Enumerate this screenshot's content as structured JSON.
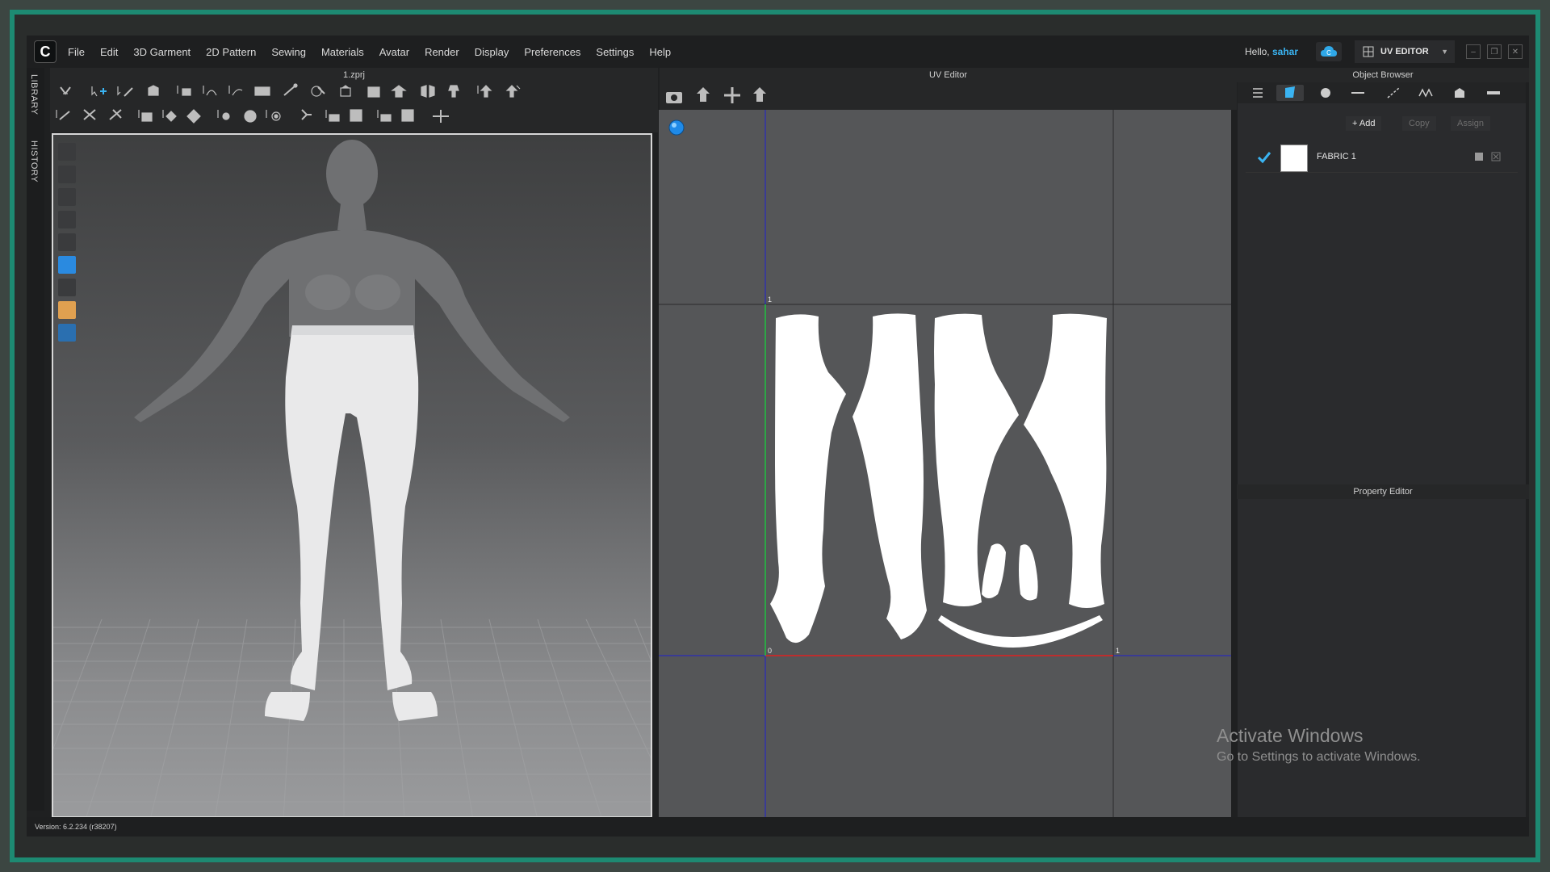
{
  "app": {
    "menu": [
      "File",
      "Edit",
      "3D Garment",
      "2D Pattern",
      "Sewing",
      "Materials",
      "Avatar",
      "Render",
      "Display",
      "Preferences",
      "Settings",
      "Help"
    ],
    "hello_prefix": "Hello,",
    "username": "sahar",
    "mode": "UV EDITOR",
    "window_controls": [
      "–",
      "❐",
      "✕"
    ]
  },
  "side_tabs": [
    "LIBRARY",
    "HISTORY"
  ],
  "viewport3d": {
    "title": "1.zprj"
  },
  "uv_editor": {
    "title": "UV Editor",
    "axis_labels": {
      "top_left": "1",
      "origin": "0",
      "right": "1"
    }
  },
  "object_browser": {
    "title": "Object Browser",
    "add_label": "+ Add",
    "copy_label": "Copy",
    "assign_label": "Assign",
    "fabric": {
      "name": "FABRIC 1",
      "checked": true
    }
  },
  "property_editor": {
    "title": "Property Editor"
  },
  "watermark": {
    "line1": "Activate Windows",
    "line2": "Go to Settings to activate Windows."
  },
  "status": {
    "version": "Version: 6.2.234 (r38207)"
  },
  "colors": {
    "accent": "#3ab4f2",
    "frame": "#1d8a72",
    "uv_u_axis": "#e02020",
    "uv_v_axis": "#20c040",
    "uv_grid": "#2020d0"
  }
}
